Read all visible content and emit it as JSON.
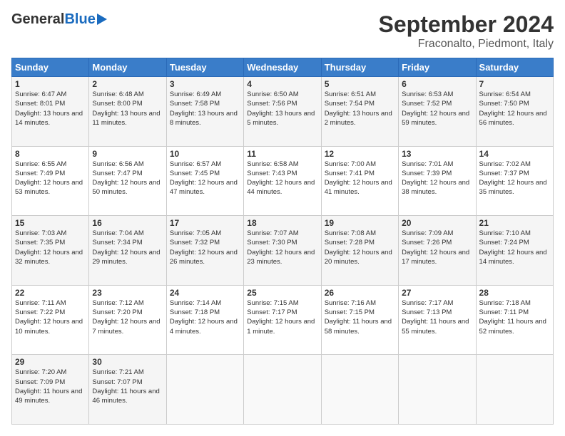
{
  "logo": {
    "general": "General",
    "blue": "Blue"
  },
  "header": {
    "month_year": "September 2024",
    "location": "Fraconalto, Piedmont, Italy"
  },
  "days_of_week": [
    "Sunday",
    "Monday",
    "Tuesday",
    "Wednesday",
    "Thursday",
    "Friday",
    "Saturday"
  ],
  "weeks": [
    [
      {
        "day": "1",
        "sunrise": "6:47 AM",
        "sunset": "8:01 PM",
        "daylight": "13 hours and 14 minutes."
      },
      {
        "day": "2",
        "sunrise": "6:48 AM",
        "sunset": "8:00 PM",
        "daylight": "13 hours and 11 minutes."
      },
      {
        "day": "3",
        "sunrise": "6:49 AM",
        "sunset": "7:58 PM",
        "daylight": "13 hours and 8 minutes."
      },
      {
        "day": "4",
        "sunrise": "6:50 AM",
        "sunset": "7:56 PM",
        "daylight": "13 hours and 5 minutes."
      },
      {
        "day": "5",
        "sunrise": "6:51 AM",
        "sunset": "7:54 PM",
        "daylight": "13 hours and 2 minutes."
      },
      {
        "day": "6",
        "sunrise": "6:53 AM",
        "sunset": "7:52 PM",
        "daylight": "12 hours and 59 minutes."
      },
      {
        "day": "7",
        "sunrise": "6:54 AM",
        "sunset": "7:50 PM",
        "daylight": "12 hours and 56 minutes."
      }
    ],
    [
      {
        "day": "8",
        "sunrise": "6:55 AM",
        "sunset": "7:49 PM",
        "daylight": "12 hours and 53 minutes."
      },
      {
        "day": "9",
        "sunrise": "6:56 AM",
        "sunset": "7:47 PM",
        "daylight": "12 hours and 50 minutes."
      },
      {
        "day": "10",
        "sunrise": "6:57 AM",
        "sunset": "7:45 PM",
        "daylight": "12 hours and 47 minutes."
      },
      {
        "day": "11",
        "sunrise": "6:58 AM",
        "sunset": "7:43 PM",
        "daylight": "12 hours and 44 minutes."
      },
      {
        "day": "12",
        "sunrise": "7:00 AM",
        "sunset": "7:41 PM",
        "daylight": "12 hours and 41 minutes."
      },
      {
        "day": "13",
        "sunrise": "7:01 AM",
        "sunset": "7:39 PM",
        "daylight": "12 hours and 38 minutes."
      },
      {
        "day": "14",
        "sunrise": "7:02 AM",
        "sunset": "7:37 PM",
        "daylight": "12 hours and 35 minutes."
      }
    ],
    [
      {
        "day": "15",
        "sunrise": "7:03 AM",
        "sunset": "7:35 PM",
        "daylight": "12 hours and 32 minutes."
      },
      {
        "day": "16",
        "sunrise": "7:04 AM",
        "sunset": "7:34 PM",
        "daylight": "12 hours and 29 minutes."
      },
      {
        "day": "17",
        "sunrise": "7:05 AM",
        "sunset": "7:32 PM",
        "daylight": "12 hours and 26 minutes."
      },
      {
        "day": "18",
        "sunrise": "7:07 AM",
        "sunset": "7:30 PM",
        "daylight": "12 hours and 23 minutes."
      },
      {
        "day": "19",
        "sunrise": "7:08 AM",
        "sunset": "7:28 PM",
        "daylight": "12 hours and 20 minutes."
      },
      {
        "day": "20",
        "sunrise": "7:09 AM",
        "sunset": "7:26 PM",
        "daylight": "12 hours and 17 minutes."
      },
      {
        "day": "21",
        "sunrise": "7:10 AM",
        "sunset": "7:24 PM",
        "daylight": "12 hours and 14 minutes."
      }
    ],
    [
      {
        "day": "22",
        "sunrise": "7:11 AM",
        "sunset": "7:22 PM",
        "daylight": "12 hours and 10 minutes."
      },
      {
        "day": "23",
        "sunrise": "7:12 AM",
        "sunset": "7:20 PM",
        "daylight": "12 hours and 7 minutes."
      },
      {
        "day": "24",
        "sunrise": "7:14 AM",
        "sunset": "7:18 PM",
        "daylight": "12 hours and 4 minutes."
      },
      {
        "day": "25",
        "sunrise": "7:15 AM",
        "sunset": "7:17 PM",
        "daylight": "12 hours and 1 minute."
      },
      {
        "day": "26",
        "sunrise": "7:16 AM",
        "sunset": "7:15 PM",
        "daylight": "11 hours and 58 minutes."
      },
      {
        "day": "27",
        "sunrise": "7:17 AM",
        "sunset": "7:13 PM",
        "daylight": "11 hours and 55 minutes."
      },
      {
        "day": "28",
        "sunrise": "7:18 AM",
        "sunset": "7:11 PM",
        "daylight": "11 hours and 52 minutes."
      }
    ],
    [
      {
        "day": "29",
        "sunrise": "7:20 AM",
        "sunset": "7:09 PM",
        "daylight": "11 hours and 49 minutes."
      },
      {
        "day": "30",
        "sunrise": "7:21 AM",
        "sunset": "7:07 PM",
        "daylight": "11 hours and 46 minutes."
      },
      null,
      null,
      null,
      null,
      null
    ]
  ]
}
